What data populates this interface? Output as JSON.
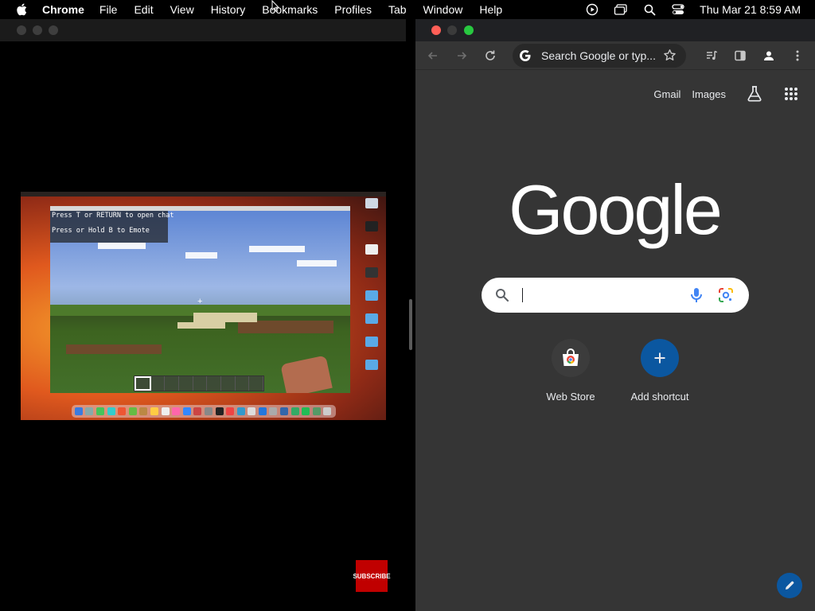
{
  "menubar": {
    "app_name": "Chrome",
    "items": [
      "File",
      "Edit",
      "View",
      "History",
      "Bookmarks",
      "Profiles",
      "Tab",
      "Window",
      "Help"
    ],
    "status_icons": [
      "play-circle-icon",
      "screen-mirroring-icon",
      "search-icon",
      "control-center-icon"
    ],
    "clock": "Thu Mar 21  8:59 AM"
  },
  "video_player": {
    "game_overlay": {
      "chat_line_1": "Press T or RETURN to open chat",
      "chat_line_2": "Press or Hold B to Emote"
    },
    "subscribe_badge": "SUBSCRIBE"
  },
  "chrome": {
    "omnibox": {
      "text": "Search Google or type a URL",
      "display_text": "Search Google or typ..."
    },
    "toolbar_icons": [
      "back-icon",
      "forward-icon",
      "reload-icon",
      "google-g-icon",
      "star-icon",
      "media-controls-icon",
      "side-panel-icon",
      "profile-icon",
      "more-menu-icon"
    ],
    "ntp": {
      "links": {
        "gmail": "Gmail",
        "images": "Images"
      },
      "logo": "Google",
      "search_placeholder": "",
      "shortcuts": [
        {
          "label": "Web Store",
          "icon": "web-store-icon"
        },
        {
          "label": "Add shortcut",
          "icon": "plus-icon"
        }
      ]
    },
    "colors": {
      "background": "#353535",
      "toolbar_bg": "#353535",
      "accent": "#0b57a0",
      "text": "#e8eaed"
    }
  }
}
